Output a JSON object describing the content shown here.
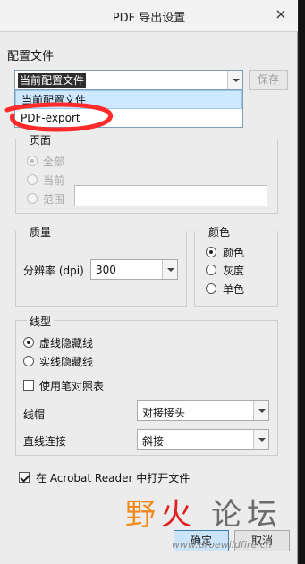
{
  "dialog": {
    "title": "PDF 导出设置",
    "close_glyph": "×"
  },
  "profile": {
    "section_label": "配置文件",
    "current_value": "当前配置文件",
    "save_label": "保存",
    "options": [
      "当前配置文件",
      "PDF-export"
    ]
  },
  "pages": {
    "group_label": "页面",
    "all_label": "全部",
    "current_label": "当前",
    "range_label": "范围",
    "selected": "全部"
  },
  "quality": {
    "group_label": "质量",
    "resolution_label": "分辨率 (dpi)",
    "resolution_value": "300"
  },
  "color": {
    "group_label": "颜色",
    "options": [
      "颜色",
      "灰度",
      "单色"
    ],
    "selected": "颜色"
  },
  "linetype": {
    "group_label": "线型",
    "hidden_dashed": "虚线隐藏线",
    "hidden_solid": "实线隐藏线",
    "selected": "虚线隐藏线",
    "pen_table_label": "使用笔对照表",
    "pen_table_checked": false,
    "line_cap_label": "线帽",
    "line_cap_value": "对接接头",
    "line_join_label": "直线连接",
    "line_join_value": "斜接"
  },
  "open_in_reader": {
    "label": "在 Acrobat Reader 中打开文件",
    "checked": true
  },
  "buttons": {
    "ok": "确定",
    "cancel": "取消"
  },
  "watermark": {
    "chars": [
      "野",
      "火",
      "论",
      "坛"
    ],
    "url": "www.proewildfire.cn",
    "colors": {
      "orange": "#f28a1e",
      "red": "#e02020",
      "gray": "#6c6c6c"
    }
  },
  "annotation": {
    "color": "#ff2a2a"
  }
}
